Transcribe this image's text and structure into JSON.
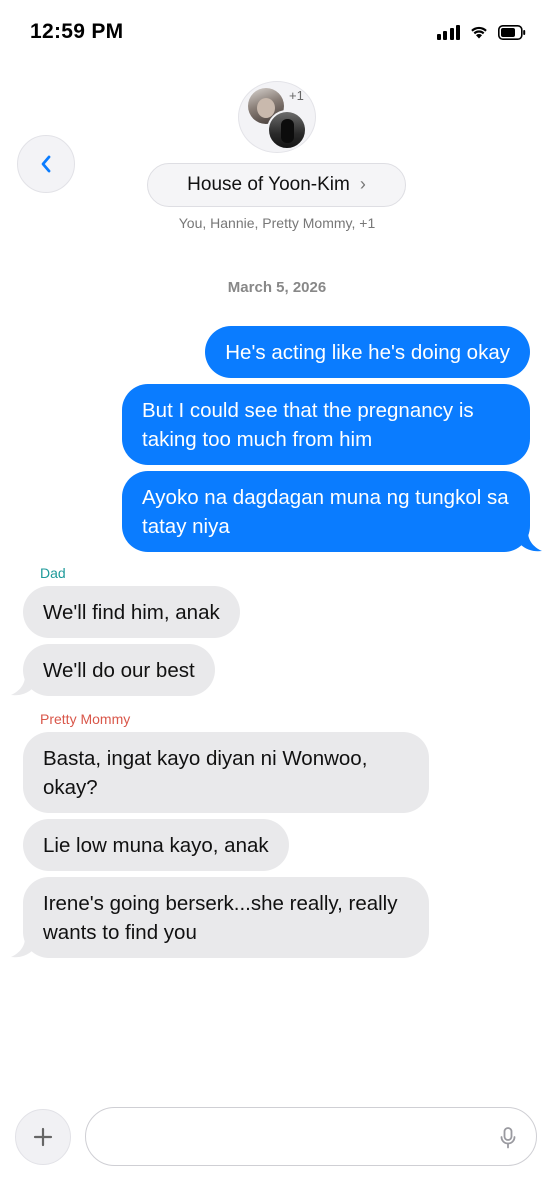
{
  "status": {
    "time": "12:59 PM"
  },
  "header": {
    "avatar_extra": "+1",
    "title": "House of Yoon-Kim",
    "chevron": "›",
    "members": "You, Hannie, Pretty Mommy, +1"
  },
  "date": "March 5, 2026",
  "outgoing": [
    {
      "text": "He's acting like he's doing okay"
    },
    {
      "text": "But I could see that the pregnancy is taking too much from him"
    },
    {
      "text": "Ayoko na dagdagan muna ng tungkol sa tatay niya"
    }
  ],
  "groups": [
    {
      "sender": "Dad",
      "sender_color": "#1e9a9a",
      "messages": [
        {
          "text": "We'll find him, anak"
        },
        {
          "text": "We'll do our best"
        }
      ]
    },
    {
      "sender": "Pretty Mommy",
      "sender_color": "#d9574a",
      "messages": [
        {
          "text": "Basta, ingat kayo diyan ni Wonwoo, okay?"
        },
        {
          "text": "Lie low muna kayo, anak"
        },
        {
          "text": "Irene's going berserk...she really, really wants to find you"
        }
      ]
    }
  ],
  "composer": {
    "placeholder": "",
    "value": ""
  },
  "colors": {
    "outgoing_bubble": "#0a7cff",
    "incoming_bubble": "#e9e9eb",
    "accent": "#0a7cff"
  },
  "icons": [
    "back-chevron-icon",
    "chevron-right-icon",
    "plus-icon",
    "microphone-icon",
    "signal-icon",
    "wifi-icon",
    "battery-icon"
  ]
}
